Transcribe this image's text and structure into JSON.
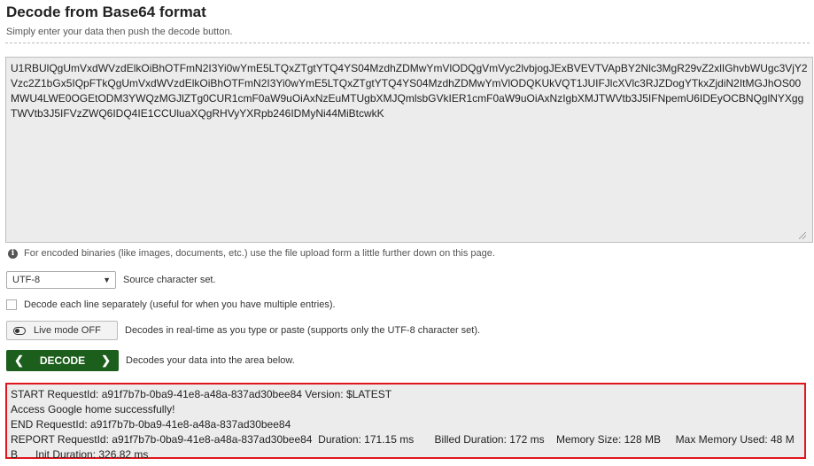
{
  "header": {
    "title": "Decode from Base64 format",
    "subtitle": "Simply enter your data then push the decode button."
  },
  "input": {
    "value": "U1RBUlQgUmVxdWVzdElkOiBhOTFmN2I3Yi0wYmE5LTQxZTgtYTQ4YS04MzdhZDMwYmVlODQgVmVyc2lvbjogJExBVEVTVApBY2Nlc3MgR29vZ2xlIGhvbWUgc3VjY2Vzc2Z1bGx5IQpFTkQgUmVxdWVzdElkOiBhOTFmN2I3Yi0wYmE5LTQxZTgtYTQ4YS04MzdhZDMwYmVlODQKUkVQT1JUIFJlcXVlc3RJZDogYTkxZjdiN2ItMGJhOS00MWU4LWE0OGEtODM3YWQzMGJlZTg0CUR1cmF0aW9uOiAxNzEuMTUgbXMJQmlsbGVkIER1cmF0aW9uOiAxNzIgbXMJTWVtb3J5IFNpemU6IDEyOCBNQglNYXggTWVtb3J5IFVzZWQ6IDQ4IE1CCUluaXQgRHVyYXRpb246IDMyNi44MiBtcwkK"
  },
  "note": {
    "text": "For encoded binaries (like images, documents, etc.) use the file upload form a little further down on this page."
  },
  "charset": {
    "selected": "UTF-8",
    "label": "Source character set."
  },
  "each_line": {
    "label": "Decode each line separately (useful for when you have multiple entries)."
  },
  "live_mode": {
    "button_label": "Live mode OFF",
    "description": "Decodes in real-time as you type or paste (supports only the UTF-8 character set)."
  },
  "decode": {
    "button_label": "DECODE",
    "description": "Decodes your data into the area below."
  },
  "output": {
    "lines": [
      "START RequestId: a91f7b7b-0ba9-41e8-a48a-837ad30bee84 Version: $LATEST",
      "Access Google home successfully!",
      "END RequestId: a91f7b7b-0ba9-41e8-a48a-837ad30bee84",
      "REPORT RequestId: a91f7b7b-0ba9-41e8-a48a-837ad30bee84  Duration: 171.15 ms       Billed Duration: 172 ms    Memory Size: 128 MB     Max Memory Used: 48 M",
      "B      Init Duration: 326.82 ms"
    ]
  },
  "colors": {
    "decode_button": "#1c5e1c",
    "output_highlight_border": "#e0161c"
  },
  "icons": {
    "info": "info-icon",
    "toggle": "toggle-icon",
    "select_arrow": "chevron-down-icon",
    "decode_left": "chevron-left-icon",
    "decode_right": "chevron-right-icon"
  }
}
